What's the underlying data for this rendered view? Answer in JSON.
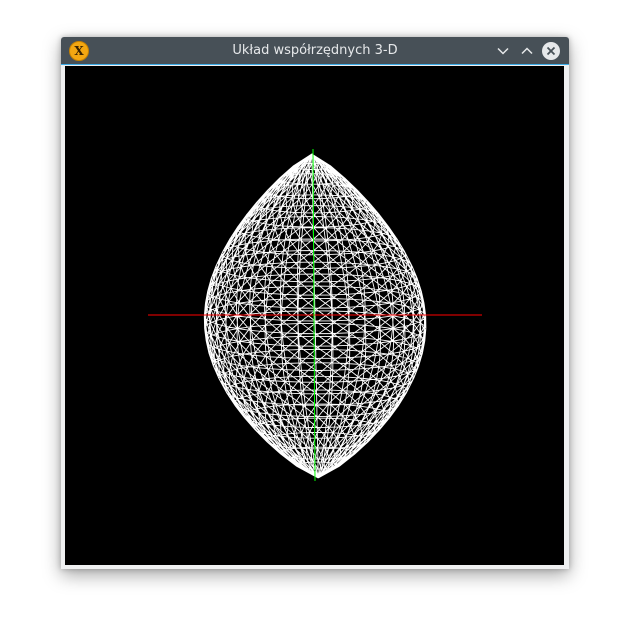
{
  "window": {
    "title": "Układ współrzędnych 3-D",
    "app_icon_glyph": "X",
    "app_icon_name": "x-server-icon",
    "buttons": {
      "minimize_icon": "chevron-down-icon",
      "maximize_icon": "chevron-up-icon",
      "close_icon": "close-icon"
    }
  },
  "scene": {
    "background": "#000000",
    "mesh_color": "#ffffff",
    "x_axis_color": "#ff0000",
    "y_axis_color": "#00ff00",
    "object": "egg-wireframe"
  }
}
